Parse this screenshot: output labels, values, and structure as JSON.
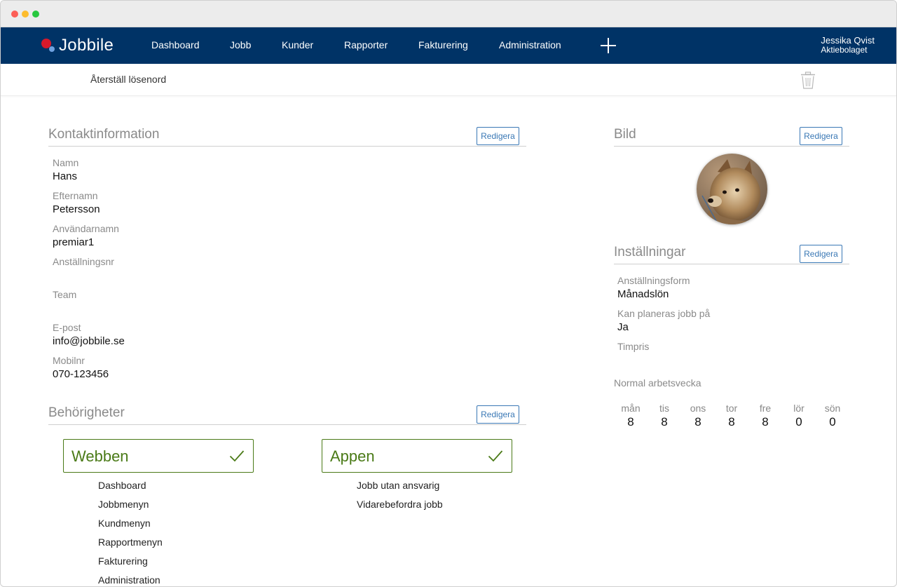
{
  "nav": {
    "logo_text": "Jobbile",
    "items": [
      "Dashboard",
      "Jobb",
      "Kunder",
      "Rapporter",
      "Fakturering",
      "Administration"
    ],
    "user_name": "Jessika Qvist",
    "user_company": "Aktiebolaget"
  },
  "subbar": {
    "reset_label": "Återställ lösenord"
  },
  "contact": {
    "title": "Kontaktinformation",
    "edit_label": "Redigera",
    "fields": [
      {
        "label": "Namn",
        "value": "Hans"
      },
      {
        "label": "Efternamn",
        "value": "Petersson"
      },
      {
        "label": "Användarnamn",
        "value": "premiar1"
      },
      {
        "label": "Anställningsnr",
        "value": ""
      },
      {
        "label": "Team",
        "value": ""
      },
      {
        "label": "E-post",
        "value": "info@jobbile.se"
      },
      {
        "label": "Mobilnr",
        "value": "070-123456"
      }
    ]
  },
  "permissions": {
    "title": "Behörigheter",
    "edit_label": "Redigera",
    "web": {
      "title": "Webben",
      "items": [
        "Dashboard",
        "Jobbmenyn",
        "Kundmenyn",
        "Rapportmenyn",
        "Fakturering",
        "Administration"
      ]
    },
    "app": {
      "title": "Appen",
      "items": [
        "Jobb utan ansvarig",
        "Vidarebefordra jobb"
      ]
    }
  },
  "picture": {
    "title": "Bild",
    "edit_label": "Redigera"
  },
  "settings": {
    "title": "Inställningar",
    "edit_label": "Redigera",
    "fields": [
      {
        "label": "Anställningsform",
        "value": "Månadslön"
      },
      {
        "label": "Kan planeras jobb på",
        "value": "Ja"
      },
      {
        "label": "Timpris",
        "value": ""
      }
    ],
    "week_label": "Normal arbetsvecka",
    "week": [
      {
        "day": "mån",
        "hours": "8"
      },
      {
        "day": "tis",
        "hours": "8"
      },
      {
        "day": "ons",
        "hours": "8"
      },
      {
        "day": "tor",
        "hours": "8"
      },
      {
        "day": "fre",
        "hours": "8"
      },
      {
        "day": "lör",
        "hours": "0"
      },
      {
        "day": "sön",
        "hours": "0"
      }
    ]
  },
  "colors": {
    "navbar": "#003366",
    "accent_blue": "#3a78b5",
    "permission_green": "#4a7a17"
  }
}
